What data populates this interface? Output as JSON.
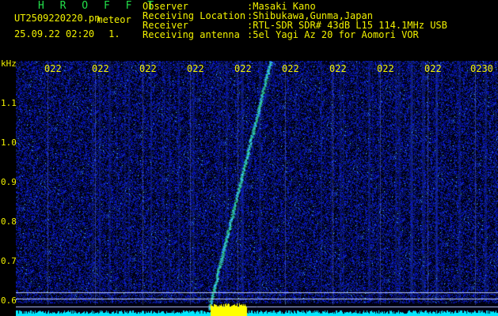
{
  "header": {
    "brand": "H R O F F T",
    "filename": "UT2509220220.pn",
    "tag": "meteor",
    "datetime": "25.09.22 02:20",
    "count": "1.",
    "fields": [
      {
        "label": "Observer",
        "value": ":Masaki Kano"
      },
      {
        "label": "Receiving Location",
        "value": ":Shibukawa,Gunma,Japan"
      },
      {
        "label": "Receiver",
        "value": ":RTL-SDR SDR# 43dB L15 114.1MHz USB"
      },
      {
        "label": "Receiving antenna",
        "value": ":5el Yagi Az 20 for Aomori VOR"
      }
    ]
  },
  "plot": {
    "unit": "kHz",
    "y_ticks": [
      "1.1",
      "1.0",
      "0.9",
      "0.8",
      "0.7",
      "0.6"
    ],
    "x_ticks": [
      "022",
      "022",
      "022",
      "022",
      "022",
      "022",
      "022",
      "022",
      "022",
      "0230"
    ],
    "colors": {
      "background": "#000010",
      "noise": "#1e3bd8",
      "trace": "#3fe0ff",
      "baseline": "#00e8ff",
      "burst": "#ffff00",
      "text": "#f2f200"
    }
  }
}
